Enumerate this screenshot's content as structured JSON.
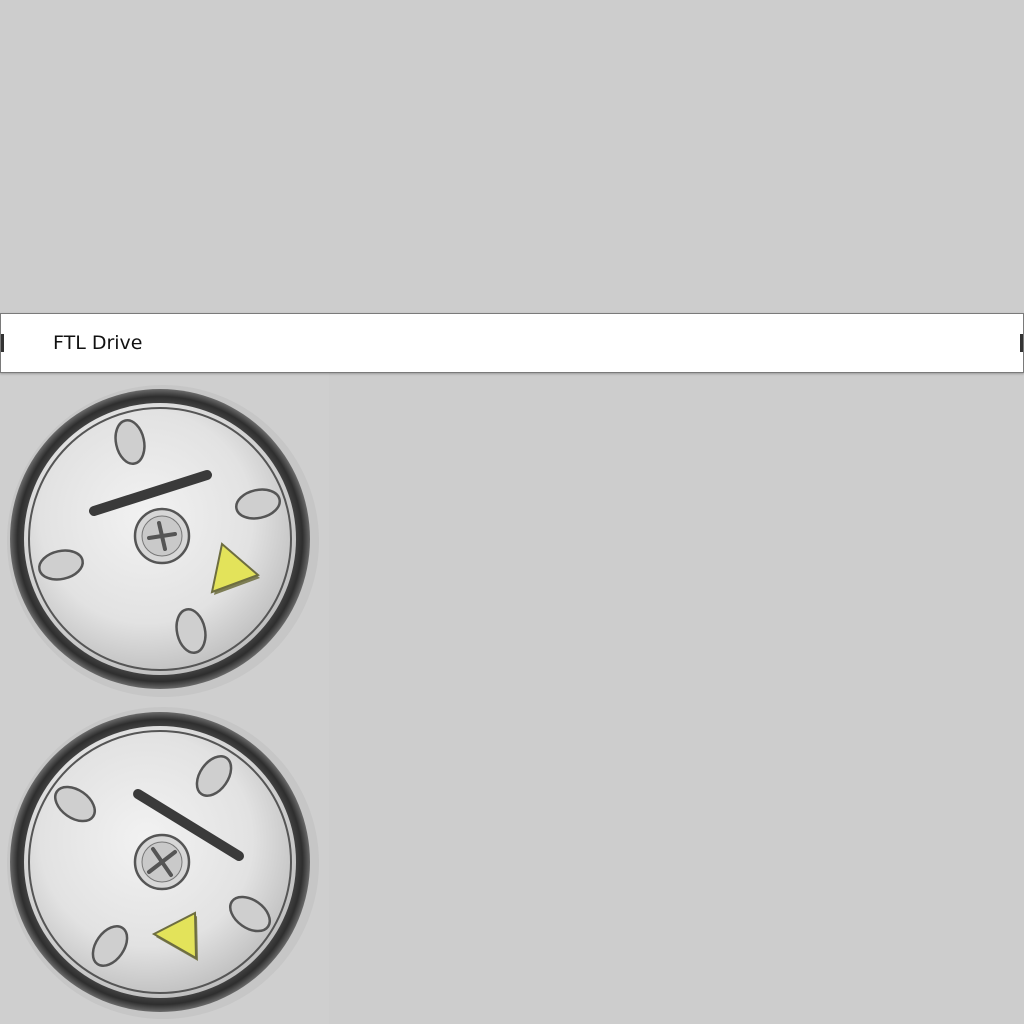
{
  "window": {
    "title": "FTL Drive"
  },
  "dials": [
    {
      "name": "dial-1",
      "needle_angle_deg": -17,
      "indicator": "arrow-right"
    },
    {
      "name": "dial-2",
      "needle_angle_deg": 34,
      "indicator": "arrow-left"
    }
  ],
  "colors": {
    "background": "#cdcdcd",
    "title_bar": "#ffffff",
    "dial_rim": "#3c3c3c",
    "dial_face": "#e6e6e6",
    "indicator": "#e3e35a"
  },
  "icons": [
    "screw-icon",
    "triangle-indicator-icon"
  ]
}
